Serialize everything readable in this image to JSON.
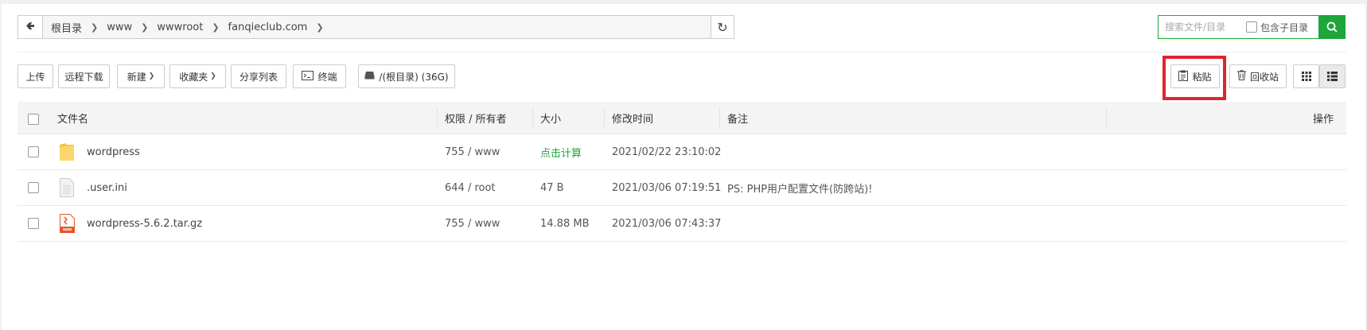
{
  "pathbar": {
    "crumbs": [
      "根目录",
      "www",
      "wwwroot",
      "fanqieclub.com"
    ]
  },
  "search": {
    "placeholder": "搜索文件/目录",
    "include_sub_label": "包含子目录"
  },
  "toolbar": {
    "upload": "上传",
    "remote_download": "远程下载",
    "new": "新建",
    "favorites": "收藏夹",
    "share_list": "分享列表",
    "terminal": "终端",
    "disk": "/(根目录) (36G)",
    "paste": "粘贴",
    "recycle_bin": "回收站"
  },
  "table": {
    "headers": {
      "name": "文件名",
      "perm": "权限 / 所有者",
      "size": "大小",
      "mtime": "修改时间",
      "remark": "备注",
      "ops": "操作"
    },
    "rows": [
      {
        "name": "wordpress",
        "type": "folder-icon",
        "perm": "755 / www",
        "size": "点击计算",
        "mtime": "2021/02/22 23:10:02",
        "remark": ""
      },
      {
        "name": ".user.ini",
        "type": "file-icon",
        "perm": "644 / root",
        "size": "47 B",
        "mtime": "2021/03/06 07:19:51",
        "remark": "PS: PHP用户配置文件(防跨站)!"
      },
      {
        "name": "wordpress-5.6.2.tar.gz",
        "type": "archive-icon",
        "perm": "755 / www",
        "size": "14.88 MB",
        "mtime": "2021/03/06 07:43:37",
        "remark": ""
      }
    ]
  },
  "colors": {
    "accent": "#20a53a",
    "highlight": "#e0252f"
  }
}
